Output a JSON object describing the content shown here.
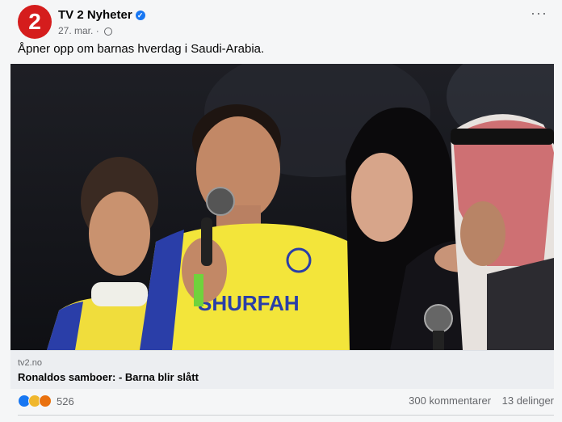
{
  "post": {
    "page_name": "TV 2 Nyheter",
    "avatar_text": "2",
    "date": "27. mar.",
    "separator": "·",
    "text": "Åpner opp om barnas hverdag i Saudi-Arabia.",
    "more_label": "···"
  },
  "image": {
    "jersey_text": "SHURFAH",
    "icon": "photo"
  },
  "link": {
    "domain": "tv2.no",
    "title": "Ronaldos samboer: - Barna blir slått"
  },
  "stats": {
    "reaction_count": "526",
    "comments": "300 kommentarer",
    "shares": "13 delinger"
  },
  "colors": {
    "brand_red": "#d51d1d",
    "verified_blue": "#1877f2",
    "jersey_yellow": "#f3e53a",
    "jersey_blue": "#2a3ea8"
  }
}
